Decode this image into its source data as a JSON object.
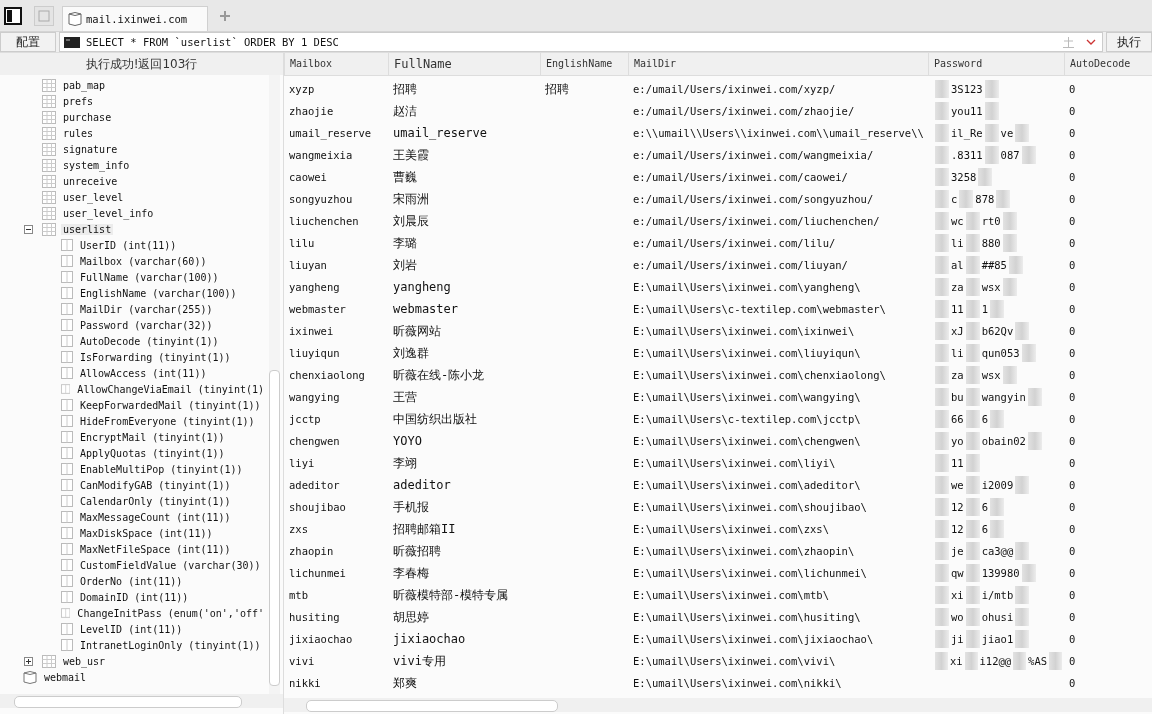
{
  "tabs": [
    {
      "label": "mail.ixinwei.com",
      "selected": true
    }
  ],
  "toolbar": {
    "config_button": "配置",
    "query": "SELECT * FROM `userlist` ORDER BY 1 DESC",
    "run_button": "执行"
  },
  "status": "执行成功!返回103行",
  "tree": {
    "tables": [
      {
        "name": "pab_map"
      },
      {
        "name": "prefs"
      },
      {
        "name": "purchase"
      },
      {
        "name": "rules"
      },
      {
        "name": "signature"
      },
      {
        "name": "system_info"
      },
      {
        "name": "unreceive"
      },
      {
        "name": "user_level"
      },
      {
        "name": "user_level_info"
      },
      {
        "name": "userlist",
        "expanded": true,
        "children": [
          {
            "name": "UserID (int(11))"
          },
          {
            "name": "Mailbox (varchar(60))"
          },
          {
            "name": "FullName (varchar(100))"
          },
          {
            "name": "EnglishName (varchar(100))"
          },
          {
            "name": "MailDir (varchar(255))"
          },
          {
            "name": "Password (varchar(32))"
          },
          {
            "name": "AutoDecode (tinyint(1))"
          },
          {
            "name": "IsForwarding (tinyint(1))"
          },
          {
            "name": "AllowAccess (int(11))"
          },
          {
            "name": "AllowChangeViaEmail (tinyint(1)"
          },
          {
            "name": "KeepForwardedMail (tinyint(1))"
          },
          {
            "name": "HideFromEveryone (tinyint(1))"
          },
          {
            "name": "EncryptMail (tinyint(1))"
          },
          {
            "name": "ApplyQuotas (tinyint(1))"
          },
          {
            "name": "EnableMultiPop (tinyint(1))"
          },
          {
            "name": "CanModifyGAB (tinyint(1))"
          },
          {
            "name": "CalendarOnly (tinyint(1))"
          },
          {
            "name": "MaxMessageCount (int(11))"
          },
          {
            "name": "MaxDiskSpace (int(11))"
          },
          {
            "name": "MaxNetFileSpace (int(11))"
          },
          {
            "name": "CustomFieldValue (varchar(30))"
          },
          {
            "name": "OrderNo (int(11))"
          },
          {
            "name": "DomainID (int(11))"
          },
          {
            "name": "ChangeInitPass (enum('on','off'"
          },
          {
            "name": "LevelID (int(11))"
          },
          {
            "name": "IntranetLoginOnly (tinyint(1))"
          }
        ]
      },
      {
        "name": "web_usr",
        "expanded": false
      }
    ],
    "databases": [
      {
        "name": "webmail"
      }
    ]
  },
  "table": {
    "columns": [
      "Mailbox",
      "FullName",
      "EnglishName",
      "MailDir",
      "Password",
      "AutoDecode"
    ],
    "rows": [
      {
        "mailbox": "xyzp",
        "fullname": "招聘",
        "englishname": "招聘",
        "maildir": "e:/umail/Users/ixinwei.com/xyzp/",
        "password": [
          "3S123"
        ],
        "autodecode": "0"
      },
      {
        "mailbox": "zhaojie",
        "fullname": "赵洁",
        "maildir": "e:/umail/Users/ixinwei.com/zhaojie/",
        "password": [
          "you11"
        ],
        "autodecode": "0"
      },
      {
        "mailbox": "umail_reserve",
        "fullname": "umail_reserve",
        "maildir": "e:\\\\umail\\\\Users\\\\ixinwei.com\\\\umail_reserve\\\\",
        "password": [
          "il_Re",
          "ve"
        ],
        "autodecode": "0"
      },
      {
        "mailbox": "wangmeixia",
        "fullname": "王美霞",
        "maildir": "e:/umail/Users/ixinwei.com/wangmeixia/",
        "password": [
          ".8311",
          "087"
        ],
        "autodecode": "0"
      },
      {
        "mailbox": "caowei",
        "fullname": "曹巍",
        "maildir": "e:/umail/Users/ixinwei.com/caowei/",
        "password": [
          "3258"
        ],
        "autodecode": "0"
      },
      {
        "mailbox": "songyuzhou",
        "fullname": "宋雨洲",
        "maildir": "e:/umail/Users/ixinwei.com/songyuzhou/",
        "password": [
          "c",
          "878"
        ],
        "autodecode": "0"
      },
      {
        "mailbox": "liuchenchen",
        "fullname": "刘晨辰",
        "maildir": "e:/umail/Users/ixinwei.com/liuchenchen/",
        "password": [
          "wc",
          "rt0"
        ],
        "autodecode": "0"
      },
      {
        "mailbox": "lilu",
        "fullname": "李璐",
        "maildir": "e:/umail/Users/ixinwei.com/lilu/",
        "password": [
          "li",
          "880"
        ],
        "autodecode": "0"
      },
      {
        "mailbox": "liuyan",
        "fullname": "刘岩",
        "maildir": "e:/umail/Users/ixinwei.com/liuyan/",
        "password": [
          "al",
          "##85"
        ],
        "autodecode": "0"
      },
      {
        "mailbox": "yangheng",
        "fullname": "yangheng",
        "maildir": "E:\\umail\\Users\\ixinwei.com\\yangheng\\",
        "password": [
          "za",
          "wsx"
        ],
        "autodecode": "0"
      },
      {
        "mailbox": "webmaster",
        "fullname": "webmaster",
        "maildir": "E:\\umail\\Users\\c-textilep.com\\webmaster\\",
        "password": [
          "11",
          "1"
        ],
        "autodecode": "0"
      },
      {
        "mailbox": "ixinwei",
        "fullname": "昕薇网站",
        "maildir": "E:\\umail\\Users\\ixinwei.com\\ixinwei\\",
        "password": [
          "xJ",
          "b62Qv"
        ],
        "autodecode": "0"
      },
      {
        "mailbox": "liuyiqun",
        "fullname": "刘逸群",
        "maildir": "E:\\umail\\Users\\ixinwei.com\\liuyiqun\\",
        "password": [
          "li",
          "qun053"
        ],
        "autodecode": "0"
      },
      {
        "mailbox": "chenxiaolong",
        "fullname": "昕薇在线-陈小龙",
        "maildir": "E:\\umail\\Users\\ixinwei.com\\chenxiaolong\\",
        "password": [
          "za",
          "wsx"
        ],
        "autodecode": "0"
      },
      {
        "mailbox": "wangying",
        "fullname": "王营",
        "maildir": "E:\\umail\\Users\\ixinwei.com\\wangying\\",
        "password": [
          "bu",
          "wangyin"
        ],
        "autodecode": "0"
      },
      {
        "mailbox": "jcctp",
        "fullname": "中国纺织出版社",
        "maildir": "E:\\umail\\Users\\c-textilep.com\\jcctp\\",
        "password": [
          "66",
          "6"
        ],
        "autodecode": "0"
      },
      {
        "mailbox": "chengwen",
        "fullname": "YOYO",
        "maildir": "E:\\umail\\Users\\ixinwei.com\\chengwen\\",
        "password": [
          "yo",
          "obain02"
        ],
        "autodecode": "0"
      },
      {
        "mailbox": "liyi",
        "fullname": "李翊",
        "maildir": "E:\\umail\\Users\\ixinwei.com\\liyi\\",
        "password": [
          "11"
        ],
        "autodecode": "0"
      },
      {
        "mailbox": "adeditor",
        "fullname": "adeditor",
        "maildir": "E:\\umail\\Users\\ixinwei.com\\adeditor\\",
        "password": [
          "we",
          "i2009"
        ],
        "autodecode": "0"
      },
      {
        "mailbox": "shoujibao",
        "fullname": "手机报",
        "maildir": "E:\\umail\\Users\\ixinwei.com\\shoujibao\\",
        "password": [
          "12",
          "6"
        ],
        "autodecode": "0"
      },
      {
        "mailbox": "zxs",
        "fullname": "招聘邮箱II",
        "maildir": "E:\\umail\\Users\\ixinwei.com\\zxs\\",
        "password": [
          "12",
          "6"
        ],
        "autodecode": "0"
      },
      {
        "mailbox": "zhaopin",
        "fullname": "昕薇招聘",
        "maildir": "E:\\umail\\Users\\ixinwei.com\\zhaopin\\",
        "password": [
          "je",
          "ca3@@"
        ],
        "autodecode": "0"
      },
      {
        "mailbox": "lichunmei",
        "fullname": "李春梅",
        "maildir": "E:\\umail\\Users\\ixinwei.com\\lichunmei\\",
        "password": [
          "qw",
          "139980"
        ],
        "autodecode": "0"
      },
      {
        "mailbox": "mtb",
        "fullname": "昕薇模特部-模特专属",
        "maildir": "E:\\umail\\Users\\ixinwei.com\\mtb\\",
        "password": [
          "xi",
          "i/mtb"
        ],
        "autodecode": "0"
      },
      {
        "mailbox": "husiting",
        "fullname": "胡思婷",
        "maildir": "E:\\umail\\Users\\ixinwei.com\\husiting\\",
        "password": [
          "wo",
          "ohusi"
        ],
        "autodecode": "0"
      },
      {
        "mailbox": "jixiaochao",
        "fullname": "jixiaochao",
        "maildir": "E:\\umail\\Users\\ixinwei.com\\jixiaochao\\",
        "password": [
          "ji",
          "jiao1"
        ],
        "autodecode": "0"
      },
      {
        "mailbox": "vivi",
        "fullname": "vivi专用",
        "maildir": "E:\\umail\\Users\\ixinwei.com\\vivi\\",
        "password": [
          "xi",
          "i12@@",
          "%AS"
        ],
        "autodecode": "0"
      },
      {
        "mailbox": "nikki",
        "fullname": "郑爽",
        "maildir": "E:\\umail\\Users\\ixinwei.com\\nikki\\",
        "autodecode": "0"
      }
    ]
  }
}
